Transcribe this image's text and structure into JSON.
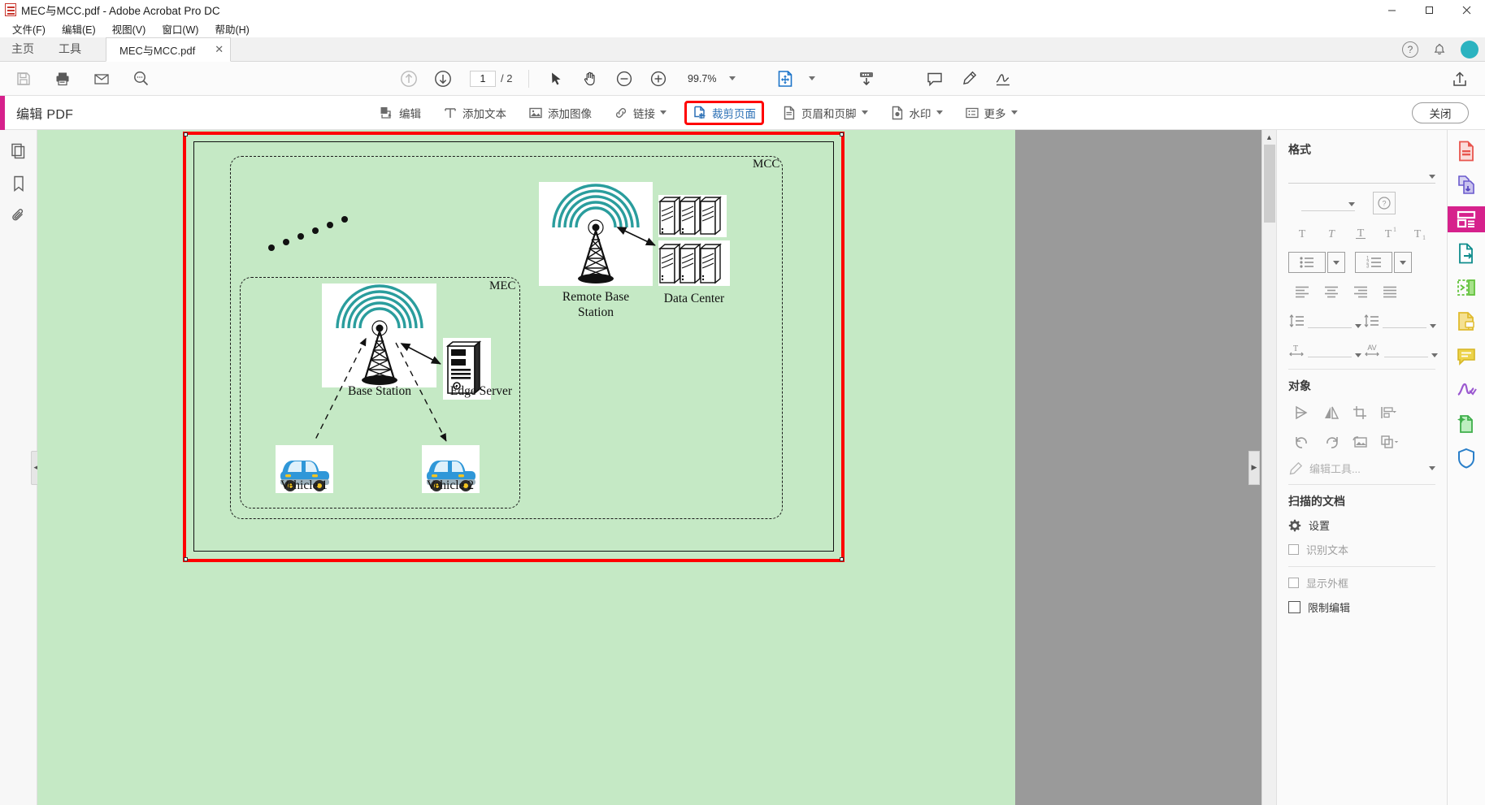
{
  "window": {
    "title": "MEC与MCC.pdf - Adobe Acrobat Pro DC",
    "app_icon": "pdf-file-icon",
    "minimize": "—",
    "maximize": "▢",
    "close": "✕"
  },
  "menubar": {
    "items": [
      {
        "label": "文件(F)",
        "name": "menu-file"
      },
      {
        "label": "编辑(E)",
        "name": "menu-edit"
      },
      {
        "label": "视图(V)",
        "name": "menu-view"
      },
      {
        "label": "窗口(W)",
        "name": "menu-window"
      },
      {
        "label": "帮助(H)",
        "name": "menu-help"
      }
    ]
  },
  "tabstrip": {
    "home": "主页",
    "tools": "工具",
    "document_tab": "MEC与MCC.pdf",
    "tab_close": "✕",
    "help_icon": "question-circle-icon",
    "bell_icon": "bell-icon",
    "avatar_icon": "user-avatar"
  },
  "toolbar": {
    "save": "save-icon",
    "print": "print-icon",
    "email": "email-icon",
    "search": "search-icon",
    "page_up": "page-up-icon",
    "page_down": "page-down-icon",
    "page_current": "1",
    "page_total": "/ 2",
    "select_tool": "cursor-icon",
    "hand_tool": "hand-icon",
    "zoom_out": "zoom-out-icon",
    "zoom_in": "zoom-in-icon",
    "zoom_value": "99.7%",
    "fit_page": "fit-page-icon",
    "download_page": "download-page-icon",
    "comment": "comment-icon",
    "highlight": "highlight-pen-icon",
    "sign": "sign-icon",
    "share": "share-icon"
  },
  "editbar": {
    "title": "编辑 PDF",
    "tools": [
      {
        "label": "编辑",
        "icon": "edit-page-icon",
        "caret": false,
        "selected": false,
        "name": "edit-tool"
      },
      {
        "label": "添加文本",
        "icon": "add-text-icon",
        "caret": false,
        "selected": false,
        "name": "add-text-tool"
      },
      {
        "label": "添加图像",
        "icon": "add-image-icon",
        "caret": false,
        "selected": false,
        "name": "add-image-tool"
      },
      {
        "label": "链接",
        "icon": "link-icon",
        "caret": true,
        "selected": false,
        "name": "link-tool"
      },
      {
        "label": "裁剪页面",
        "icon": "crop-page-icon",
        "caret": false,
        "selected": true,
        "name": "crop-page-tool"
      },
      {
        "label": "页眉和页脚",
        "icon": "header-footer-icon",
        "caret": true,
        "selected": false,
        "name": "header-footer-tool"
      },
      {
        "label": "水印",
        "icon": "watermark-icon",
        "caret": true,
        "selected": false,
        "name": "watermark-tool"
      },
      {
        "label": "更多",
        "icon": "more-list-icon",
        "caret": true,
        "selected": false,
        "name": "more-tool"
      }
    ],
    "close_label": "关闭",
    "selection_color": "#ff0000"
  },
  "left_rail": {
    "items": [
      {
        "icon": "page-thumbnails-icon",
        "name": "sidebar-thumbnails"
      },
      {
        "icon": "bookmark-icon",
        "name": "sidebar-bookmarks"
      },
      {
        "icon": "attachment-icon",
        "name": "sidebar-attachments"
      }
    ],
    "collapse_handle": "◀"
  },
  "viewer": {
    "expand_handle": "▶",
    "scroll_up": "▲",
    "page_background": "#c5e9c5"
  },
  "document": {
    "diagram": {
      "outer_label": "MCC",
      "inner_label": "MEC",
      "nodes": [
        {
          "id": "remote-base-station",
          "label": "Remote Base\nStation",
          "icon": "cell-tower-icon"
        },
        {
          "id": "data-center",
          "label": "Data Center",
          "icon": "server-rack-icon"
        },
        {
          "id": "base-station",
          "label": "Base Station",
          "icon": "cell-tower-icon"
        },
        {
          "id": "edge-server",
          "label": "Edge Server",
          "icon": "server-tower-icon"
        },
        {
          "id": "vehicle-1",
          "label": "Vehicle 1",
          "icon": "car-icon"
        },
        {
          "id": "vehicle-2",
          "label": "Vehicle 2",
          "icon": "car-icon"
        }
      ]
    }
  },
  "right_panel": {
    "format_heading": "格式",
    "object_heading": "对象",
    "scanned_heading": "扫描的文档",
    "settings_label": "设置",
    "settings_icon": "gear-icon",
    "edit_tool_placeholder": "编辑工具...",
    "text_buttons": [
      "T",
      "T",
      "T",
      "T¹",
      "T₁"
    ],
    "checkboxes": [
      {
        "label": "识别文本",
        "checked": false,
        "disabled": true,
        "name": "recognize-text-checkbox"
      },
      {
        "label": "显示外框",
        "checked": false,
        "disabled": true,
        "name": "show-outline-checkbox"
      },
      {
        "label": "限制编辑",
        "checked": false,
        "disabled": false,
        "name": "restrict-edit-checkbox"
      }
    ]
  },
  "tool_rail": {
    "items": [
      {
        "icon": "create-pdf-icon",
        "color": "#e8554e",
        "active": false,
        "name": "tool-create-pdf"
      },
      {
        "icon": "combine-files-icon",
        "color": "#6a5acd",
        "active": false,
        "name": "tool-combine-files"
      },
      {
        "icon": "edit-pdf-icon",
        "color": "#ffffff",
        "active": true,
        "name": "tool-edit-pdf"
      },
      {
        "icon": "export-pdf-icon",
        "color": "#0f8c8c",
        "active": false,
        "name": "tool-export-pdf"
      },
      {
        "icon": "organize-pages-icon",
        "color": "#63c23c",
        "active": false,
        "name": "tool-organize-pages"
      },
      {
        "icon": "comment-doc-icon",
        "color": "#e0bb2e",
        "active": false,
        "name": "tool-comment"
      },
      {
        "icon": "comment-bubble-icon",
        "color": "#d6b625",
        "active": false,
        "name": "tool-comment-bubble"
      },
      {
        "icon": "fill-sign-icon",
        "color": "#9b59d0",
        "active": false,
        "name": "tool-fill-sign"
      },
      {
        "icon": "enhance-scan-icon",
        "color": "#3fae4b",
        "active": false,
        "name": "tool-enhance-scan"
      },
      {
        "icon": "protect-icon",
        "color": "#2a7fc9",
        "active": false,
        "name": "tool-protect"
      }
    ]
  }
}
